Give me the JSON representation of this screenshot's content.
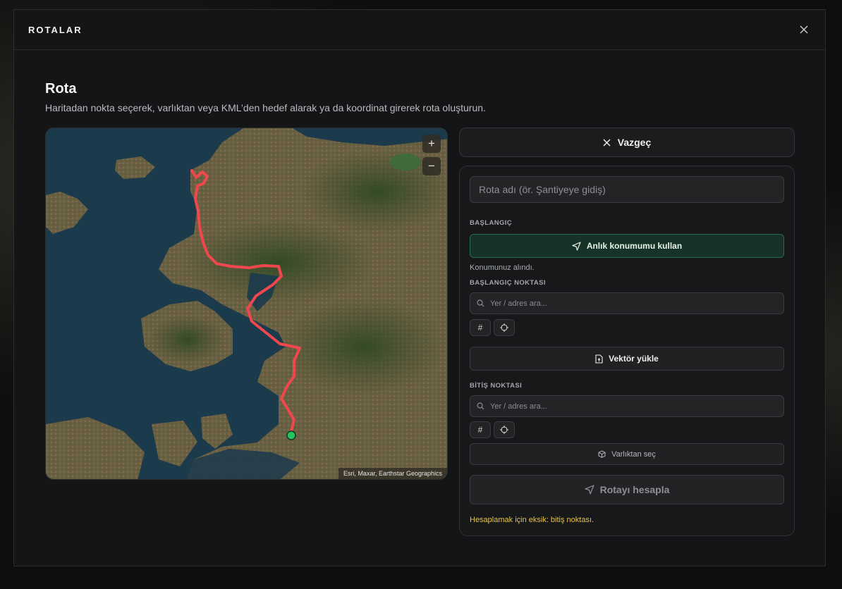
{
  "modal": {
    "title": "ROTALAR",
    "close_icon": "close-icon"
  },
  "page": {
    "heading": "Rota",
    "description": "Haritadan nokta seçerek, varlıktan veya KML’den hedef alarak ya da koordinat girerek rota oluşturun."
  },
  "map": {
    "zoom_in_label": "+",
    "zoom_out_label": "−",
    "attribution": "Esri, Maxar, Earthstar Geographics",
    "route_color": "#f0474f",
    "start_marker_color": "#22c55e"
  },
  "form": {
    "cancel_label": "Vazgeç",
    "route_name_placeholder": "Rota adı (ör. Şantiyeye gidiş)",
    "start_section_label": "BAŞLANGIÇ",
    "use_location_label": "Anlık konumumu kullan",
    "location_status": "Konumunuz alındı.",
    "start_point_label": "BAŞLANGIÇ NOKTASI",
    "start_search_placeholder": "Yer / adres ara...",
    "coord_button_symbol": "#",
    "vector_upload_label": "Vektör yükle",
    "end_point_label": "BİTİŞ NOKTASI",
    "end_search_placeholder": "Yer / adres ara...",
    "select_asset_label": "Varlıktan seç",
    "calculate_label": "Rotayı hesapla",
    "missing_warning": "Hesaplamak için eksik: bitiş noktası."
  },
  "colors": {
    "accent_green": "#173227",
    "warning": "#e4c44d"
  }
}
